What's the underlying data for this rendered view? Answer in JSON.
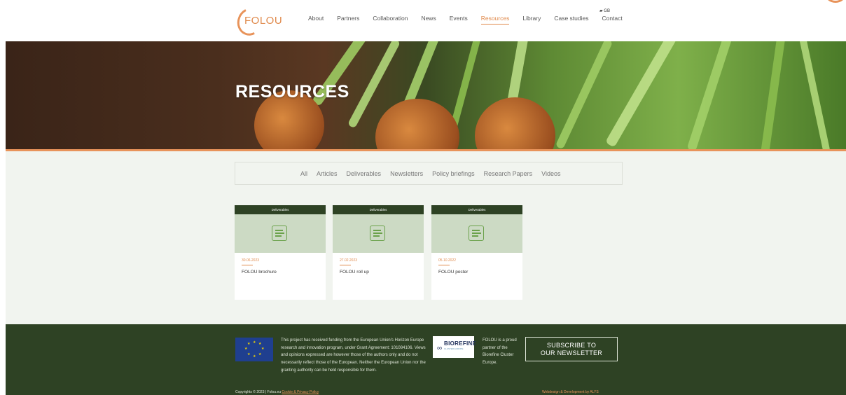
{
  "header": {
    "logo_text": "FOLOU",
    "nav": [
      {
        "label": "About"
      },
      {
        "label": "Partners"
      },
      {
        "label": "Collaboration"
      },
      {
        "label": "News"
      },
      {
        "label": "Events"
      },
      {
        "label": "Resources",
        "active": true
      },
      {
        "label": "Library"
      },
      {
        "label": "Case studies"
      },
      {
        "label": "Contact"
      }
    ],
    "lang": "GB"
  },
  "hero": {
    "title": "RESOURCES"
  },
  "filters": [
    "All",
    "Articles",
    "Deliverables",
    "Newsletters",
    "Policy briefings",
    "Research Papers",
    "Videos"
  ],
  "cards": [
    {
      "tag": "Deliverables",
      "date": "30.06.2023",
      "title": "FOLOU brochure"
    },
    {
      "tag": "Deliverables",
      "date": "27.02.2023",
      "title": "FOLOU roll up"
    },
    {
      "tag": "Deliverables",
      "date": "05.10.2022",
      "title": "FOLOU poster"
    }
  ],
  "footer": {
    "funding_text": "This project has received funding from the European Union's Horizon Europe research and innovation program, under Grant Agreement: 101084106. Views and opinions expressed are however those of the authors only and do not necessarily reflect those of the European. Neither the European Union nor the granting authority can be held responsible for them.",
    "biorefine_word": "BIOREFINE",
    "biorefine_sub": "CLUSTER EUROPE",
    "partner_text": "FOLOU is a proud partner of the Biorefine Cluster Europe.",
    "subscribe_line1": "SUBSCRIBE TO",
    "subscribe_line2": "OUR NEWSLETTER",
    "copyright": "Copyrights © 2023 | Folou.eu",
    "cookie_link": "Cookie & Privacy Policy",
    "credit": "Webdesign & Development by ALYS"
  },
  "colors": {
    "accent": "#e8935a",
    "dark_green": "#2e4224",
    "light_green": "#ccdac4",
    "icon_green": "#6aa14a"
  }
}
